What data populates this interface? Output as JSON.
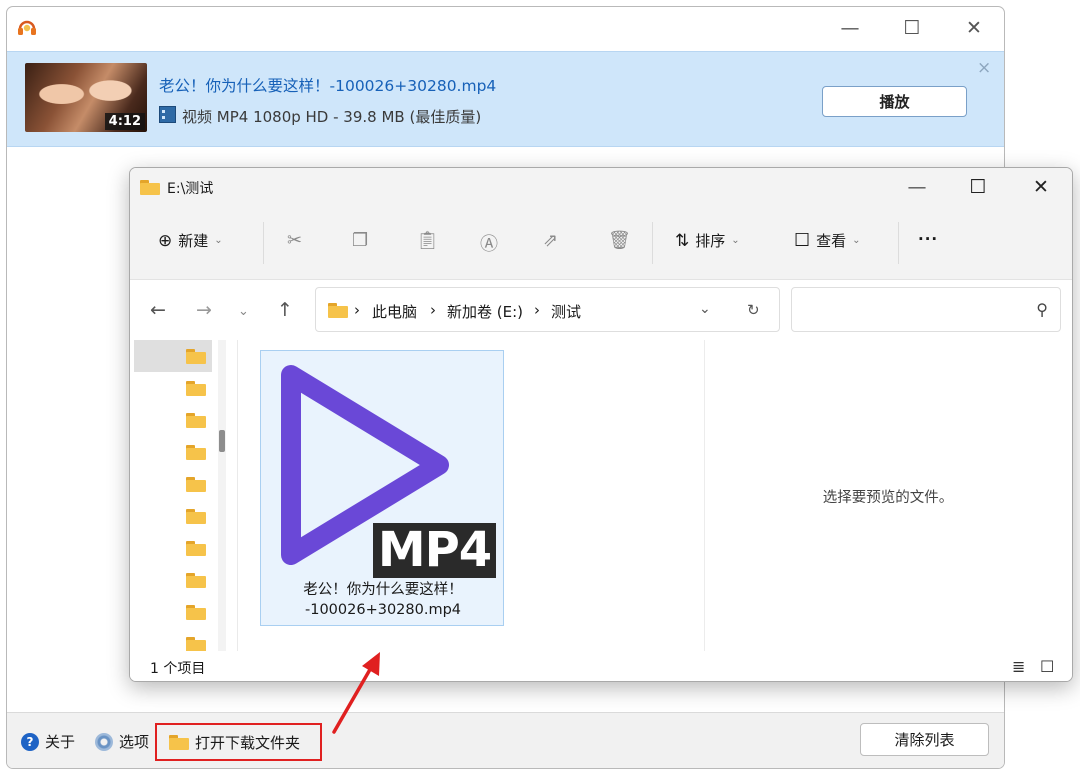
{
  "downloader": {
    "window_controls": {
      "minimize": "—",
      "maximize": "☐",
      "close": "✕"
    },
    "item": {
      "filename": "老公！你为什么要这样！-100026+30280.mp4",
      "duration": "4:12",
      "meta": "视频 MP4 1080p HD - 39.8 MB (最佳质量)",
      "play_label": "播放",
      "dismiss": "×"
    },
    "footer": {
      "about_label": "关于",
      "about_glyph": "?",
      "options_label": "选项",
      "open_folder_label": "打开下载文件夹",
      "clear_label": "清除列表"
    }
  },
  "explorer": {
    "title": "E:\\测试",
    "window_controls": {
      "minimize": "—",
      "maximize": "☐",
      "close": "✕"
    },
    "toolbar": {
      "new_label": "新建",
      "sort_label": "排序",
      "view_label": "查看",
      "more_label": "···"
    },
    "breadcrumb": [
      "此电脑",
      "新加卷 (E:)",
      "测试"
    ],
    "separator": "›",
    "search": {
      "placeholder": ""
    },
    "file": {
      "badge": "MP4",
      "name_line1": "老公！你为什么要这样！",
      "name_line2": "-100026+30280.mp4"
    },
    "preview_text": "选择要预览的文件。",
    "status": "1 个项目"
  },
  "colors": {
    "accent_blue": "#1761b8",
    "item_bg": "#cfe6fa",
    "play_icon": "#6a48d7",
    "highlight_red": "#e02020"
  },
  "icons": [
    "app-headphone-icon",
    "film-icon",
    "folder-icon",
    "about-icon",
    "gear-icon",
    "cut-icon",
    "copy-icon",
    "paste-icon",
    "rename-icon",
    "share-icon",
    "delete-icon",
    "sort-icon",
    "view-icon",
    "back-icon",
    "forward-icon",
    "refresh-icon",
    "search-icon"
  ]
}
